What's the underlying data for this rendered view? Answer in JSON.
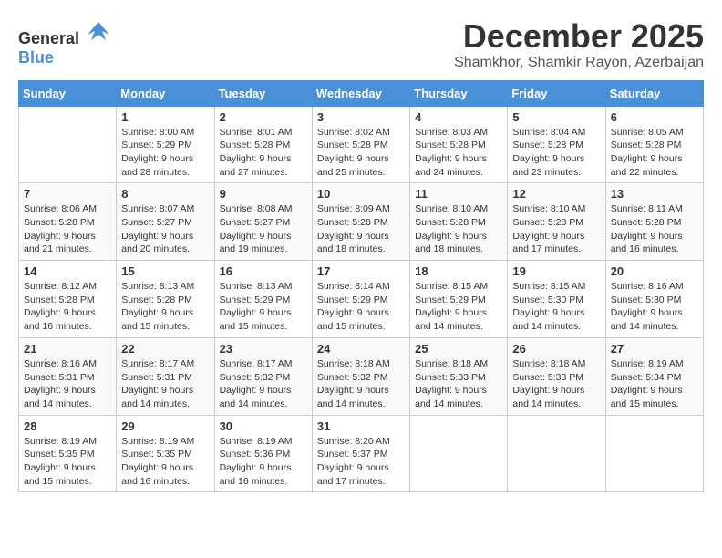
{
  "logo": {
    "text_general": "General",
    "text_blue": "Blue"
  },
  "header": {
    "month": "December 2025",
    "location": "Shamkhor, Shamkir Rayon, Azerbaijan"
  },
  "calendar": {
    "days_of_week": [
      "Sunday",
      "Monday",
      "Tuesday",
      "Wednesday",
      "Thursday",
      "Friday",
      "Saturday"
    ],
    "weeks": [
      [
        {
          "day": "",
          "info": ""
        },
        {
          "day": "1",
          "info": "Sunrise: 8:00 AM\nSunset: 5:29 PM\nDaylight: 9 hours\nand 28 minutes."
        },
        {
          "day": "2",
          "info": "Sunrise: 8:01 AM\nSunset: 5:28 PM\nDaylight: 9 hours\nand 27 minutes."
        },
        {
          "day": "3",
          "info": "Sunrise: 8:02 AM\nSunset: 5:28 PM\nDaylight: 9 hours\nand 25 minutes."
        },
        {
          "day": "4",
          "info": "Sunrise: 8:03 AM\nSunset: 5:28 PM\nDaylight: 9 hours\nand 24 minutes."
        },
        {
          "day": "5",
          "info": "Sunrise: 8:04 AM\nSunset: 5:28 PM\nDaylight: 9 hours\nand 23 minutes."
        },
        {
          "day": "6",
          "info": "Sunrise: 8:05 AM\nSunset: 5:28 PM\nDaylight: 9 hours\nand 22 minutes."
        }
      ],
      [
        {
          "day": "7",
          "info": "Sunrise: 8:06 AM\nSunset: 5:28 PM\nDaylight: 9 hours\nand 21 minutes."
        },
        {
          "day": "8",
          "info": "Sunrise: 8:07 AM\nSunset: 5:27 PM\nDaylight: 9 hours\nand 20 minutes."
        },
        {
          "day": "9",
          "info": "Sunrise: 8:08 AM\nSunset: 5:27 PM\nDaylight: 9 hours\nand 19 minutes."
        },
        {
          "day": "10",
          "info": "Sunrise: 8:09 AM\nSunset: 5:28 PM\nDaylight: 9 hours\nand 18 minutes."
        },
        {
          "day": "11",
          "info": "Sunrise: 8:10 AM\nSunset: 5:28 PM\nDaylight: 9 hours\nand 18 minutes."
        },
        {
          "day": "12",
          "info": "Sunrise: 8:10 AM\nSunset: 5:28 PM\nDaylight: 9 hours\nand 17 minutes."
        },
        {
          "day": "13",
          "info": "Sunrise: 8:11 AM\nSunset: 5:28 PM\nDaylight: 9 hours\nand 16 minutes."
        }
      ],
      [
        {
          "day": "14",
          "info": "Sunrise: 8:12 AM\nSunset: 5:28 PM\nDaylight: 9 hours\nand 16 minutes."
        },
        {
          "day": "15",
          "info": "Sunrise: 8:13 AM\nSunset: 5:28 PM\nDaylight: 9 hours\nand 15 minutes."
        },
        {
          "day": "16",
          "info": "Sunrise: 8:13 AM\nSunset: 5:29 PM\nDaylight: 9 hours\nand 15 minutes."
        },
        {
          "day": "17",
          "info": "Sunrise: 8:14 AM\nSunset: 5:29 PM\nDaylight: 9 hours\nand 15 minutes."
        },
        {
          "day": "18",
          "info": "Sunrise: 8:15 AM\nSunset: 5:29 PM\nDaylight: 9 hours\nand 14 minutes."
        },
        {
          "day": "19",
          "info": "Sunrise: 8:15 AM\nSunset: 5:30 PM\nDaylight: 9 hours\nand 14 minutes."
        },
        {
          "day": "20",
          "info": "Sunrise: 8:16 AM\nSunset: 5:30 PM\nDaylight: 9 hours\nand 14 minutes."
        }
      ],
      [
        {
          "day": "21",
          "info": "Sunrise: 8:16 AM\nSunset: 5:31 PM\nDaylight: 9 hours\nand 14 minutes."
        },
        {
          "day": "22",
          "info": "Sunrise: 8:17 AM\nSunset: 5:31 PM\nDaylight: 9 hours\nand 14 minutes."
        },
        {
          "day": "23",
          "info": "Sunrise: 8:17 AM\nSunset: 5:32 PM\nDaylight: 9 hours\nand 14 minutes."
        },
        {
          "day": "24",
          "info": "Sunrise: 8:18 AM\nSunset: 5:32 PM\nDaylight: 9 hours\nand 14 minutes."
        },
        {
          "day": "25",
          "info": "Sunrise: 8:18 AM\nSunset: 5:33 PM\nDaylight: 9 hours\nand 14 minutes."
        },
        {
          "day": "26",
          "info": "Sunrise: 8:18 AM\nSunset: 5:33 PM\nDaylight: 9 hours\nand 14 minutes."
        },
        {
          "day": "27",
          "info": "Sunrise: 8:19 AM\nSunset: 5:34 PM\nDaylight: 9 hours\nand 15 minutes."
        }
      ],
      [
        {
          "day": "28",
          "info": "Sunrise: 8:19 AM\nSunset: 5:35 PM\nDaylight: 9 hours\nand 15 minutes."
        },
        {
          "day": "29",
          "info": "Sunrise: 8:19 AM\nSunset: 5:35 PM\nDaylight: 9 hours\nand 16 minutes."
        },
        {
          "day": "30",
          "info": "Sunrise: 8:19 AM\nSunset: 5:36 PM\nDaylight: 9 hours\nand 16 minutes."
        },
        {
          "day": "31",
          "info": "Sunrise: 8:20 AM\nSunset: 5:37 PM\nDaylight: 9 hours\nand 17 minutes."
        },
        {
          "day": "",
          "info": ""
        },
        {
          "day": "",
          "info": ""
        },
        {
          "day": "",
          "info": ""
        }
      ]
    ]
  }
}
